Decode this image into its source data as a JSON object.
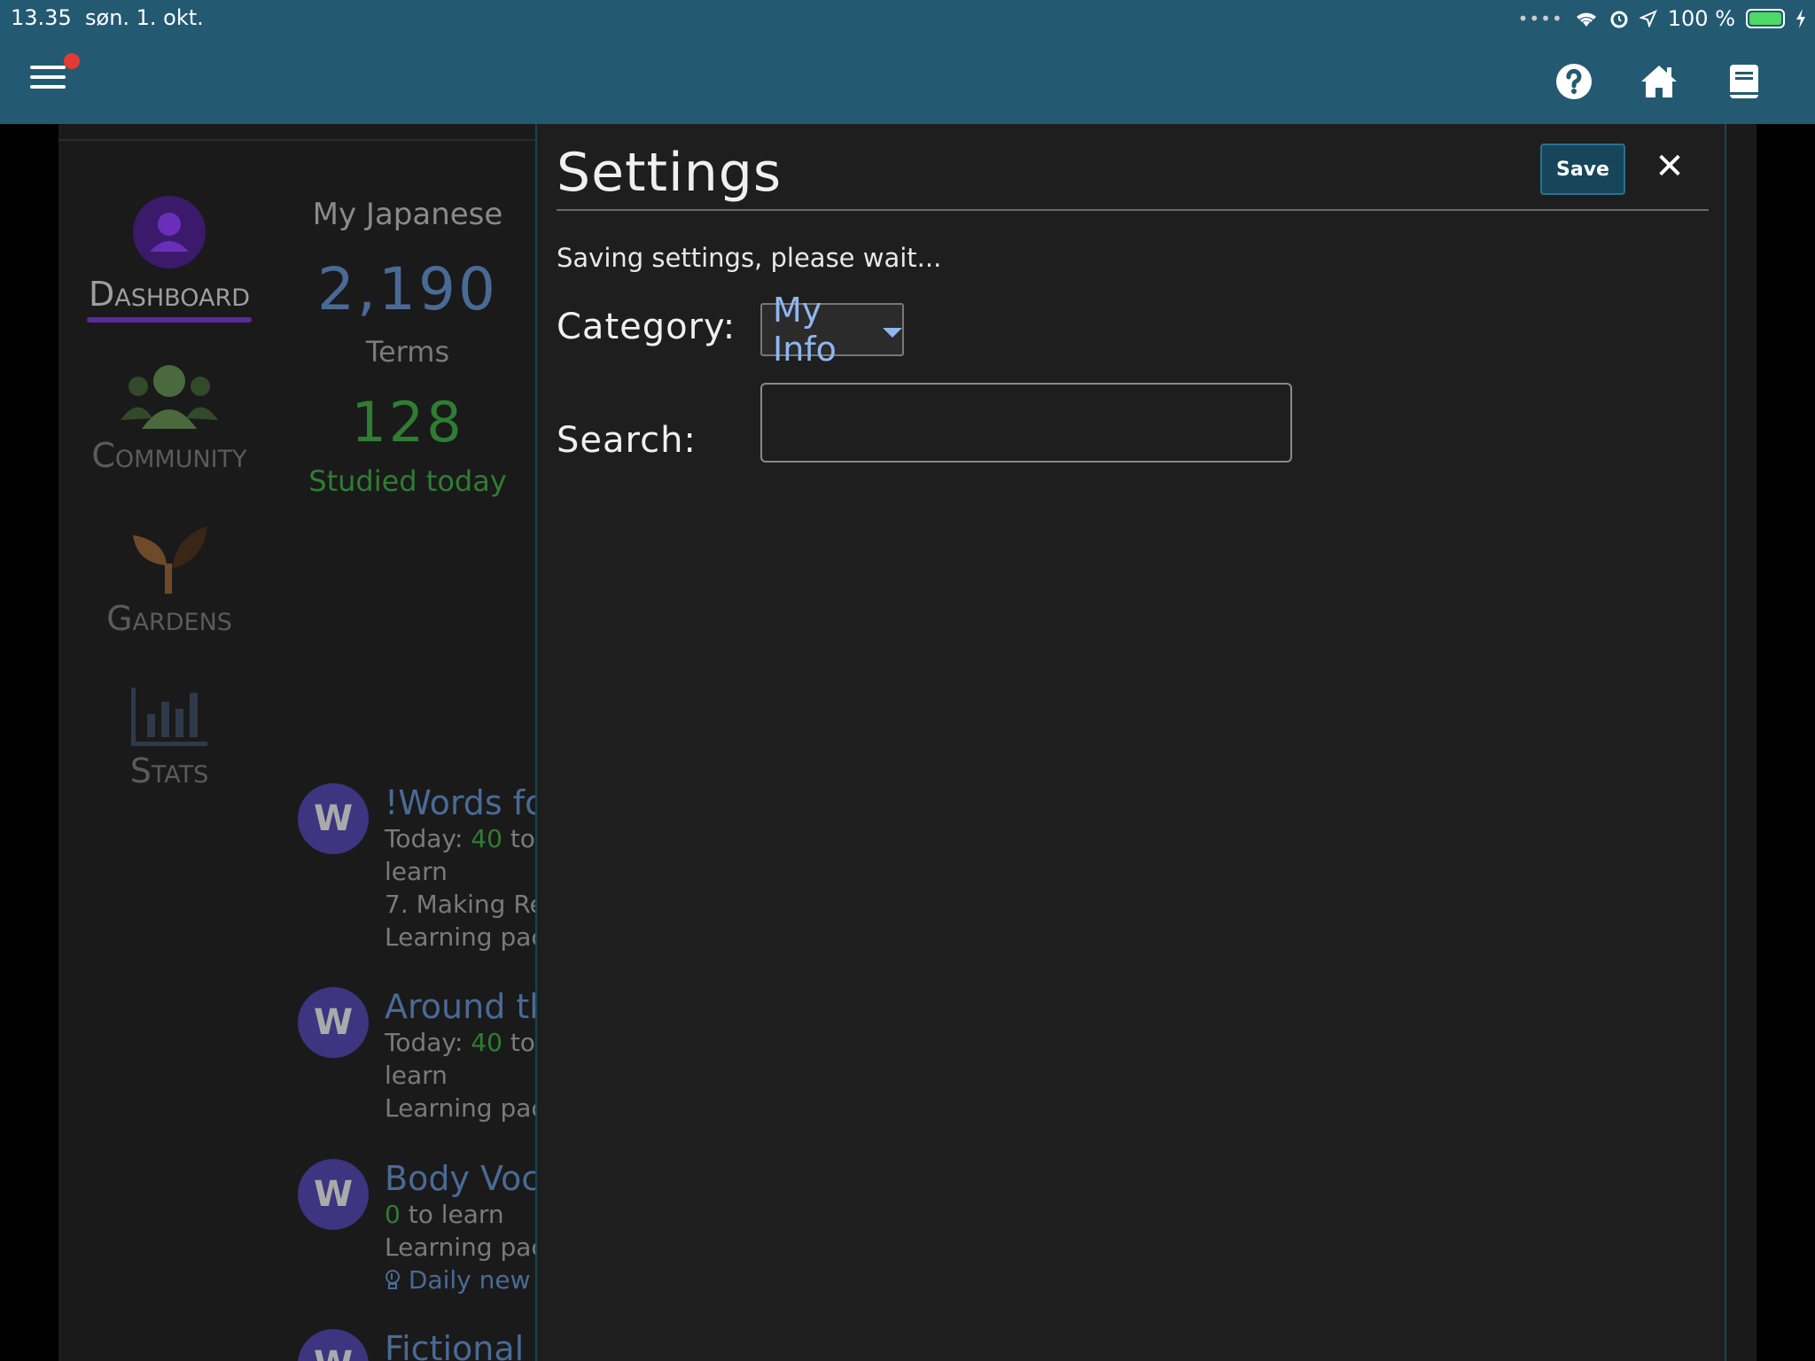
{
  "status_bar": {
    "time": "13.35",
    "date": "søn. 1. okt.",
    "battery_text": "100 %"
  },
  "topbar": {
    "menu_icon": "hamburger-icon",
    "help_icon": "help-icon",
    "home_icon": "home-icon",
    "book_icon": "book-icon"
  },
  "nav": {
    "items": [
      {
        "label": "Dashboard",
        "icon": "user-icon",
        "active": true
      },
      {
        "label": "Community",
        "icon": "people-icon",
        "active": false
      },
      {
        "label": "Gardens",
        "icon": "sprout-icon",
        "active": false
      },
      {
        "label": "Stats",
        "icon": "bar-chart-icon",
        "active": false
      }
    ]
  },
  "summary": {
    "course_title": "My Japanese",
    "terms_count": "2,190",
    "terms_label": "Terms",
    "studied_count": "128",
    "studied_label": "Studied today"
  },
  "courses": [
    {
      "avatar": "W",
      "name": "!Words fo",
      "today_prefix": "Today:",
      "to_learn_count": "40",
      "to_learn_suffix": "to",
      "line2": "learn",
      "line3_prefix": "7.",
      "line3": "Making Re",
      "line4": "Learning pac"
    },
    {
      "avatar": "W",
      "name": "Around th",
      "today_prefix": "Today:",
      "to_learn_count": "40",
      "to_learn_suffix": "to",
      "line2": "learn",
      "line3": "Learning pac"
    },
    {
      "avatar": "W",
      "name": "Body Voc",
      "to_learn_count": "0",
      "to_learn_suffix": "to learn",
      "line3": "Learning pac",
      "daily_new": "Daily new t"
    },
    {
      "avatar": "W",
      "name": "Fictional"
    }
  ],
  "settings": {
    "title": "Settings",
    "save_label": "Save",
    "close_icon": "close-icon",
    "status_message": "Saving settings, please wait...",
    "category_label": "Category:",
    "category_value": "My Info",
    "search_label": "Search:",
    "search_value": ""
  },
  "colors": {
    "topbar": "#235a72",
    "panel_bg": "#1e1e1e",
    "save_button": "#17465a",
    "select_text": "#8fb6ee",
    "studied_green": "#2e7d32",
    "nav_active_underline": "#5b2a9e"
  }
}
